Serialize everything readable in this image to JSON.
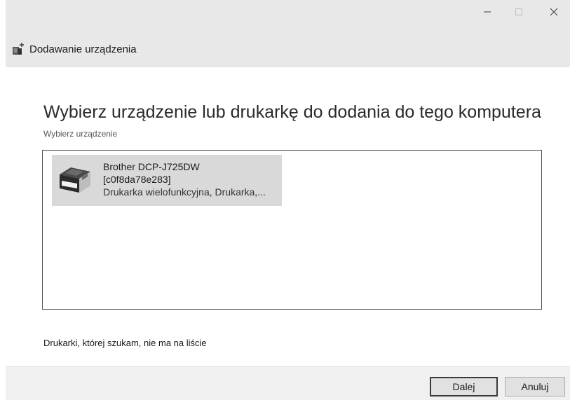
{
  "window": {
    "title": "Dodawanie urządzenia",
    "controls": [
      "minimize",
      "maximize",
      "close"
    ]
  },
  "main": {
    "heading": "Wybierz urządzenie lub drukarkę do dodania do tego komputera",
    "subheading": "Wybierz urządzenie",
    "devices": [
      {
        "name": "Brother DCP-J725DW",
        "id": "[c0f8da78e283]",
        "type": "Drukarka wielofunkcyjna, Drukarka,...",
        "icon": "printer-icon",
        "selected": true
      }
    ],
    "missing_link": "Drukarki, której szukam, nie ma na liście"
  },
  "footer": {
    "next_label": "Dalej",
    "cancel_label": "Anuluj"
  },
  "colors": {
    "titlebar_bg": "#e8e8e8",
    "selected_item_bg": "#d9d9d9",
    "footer_bg": "#f0f0f0"
  }
}
